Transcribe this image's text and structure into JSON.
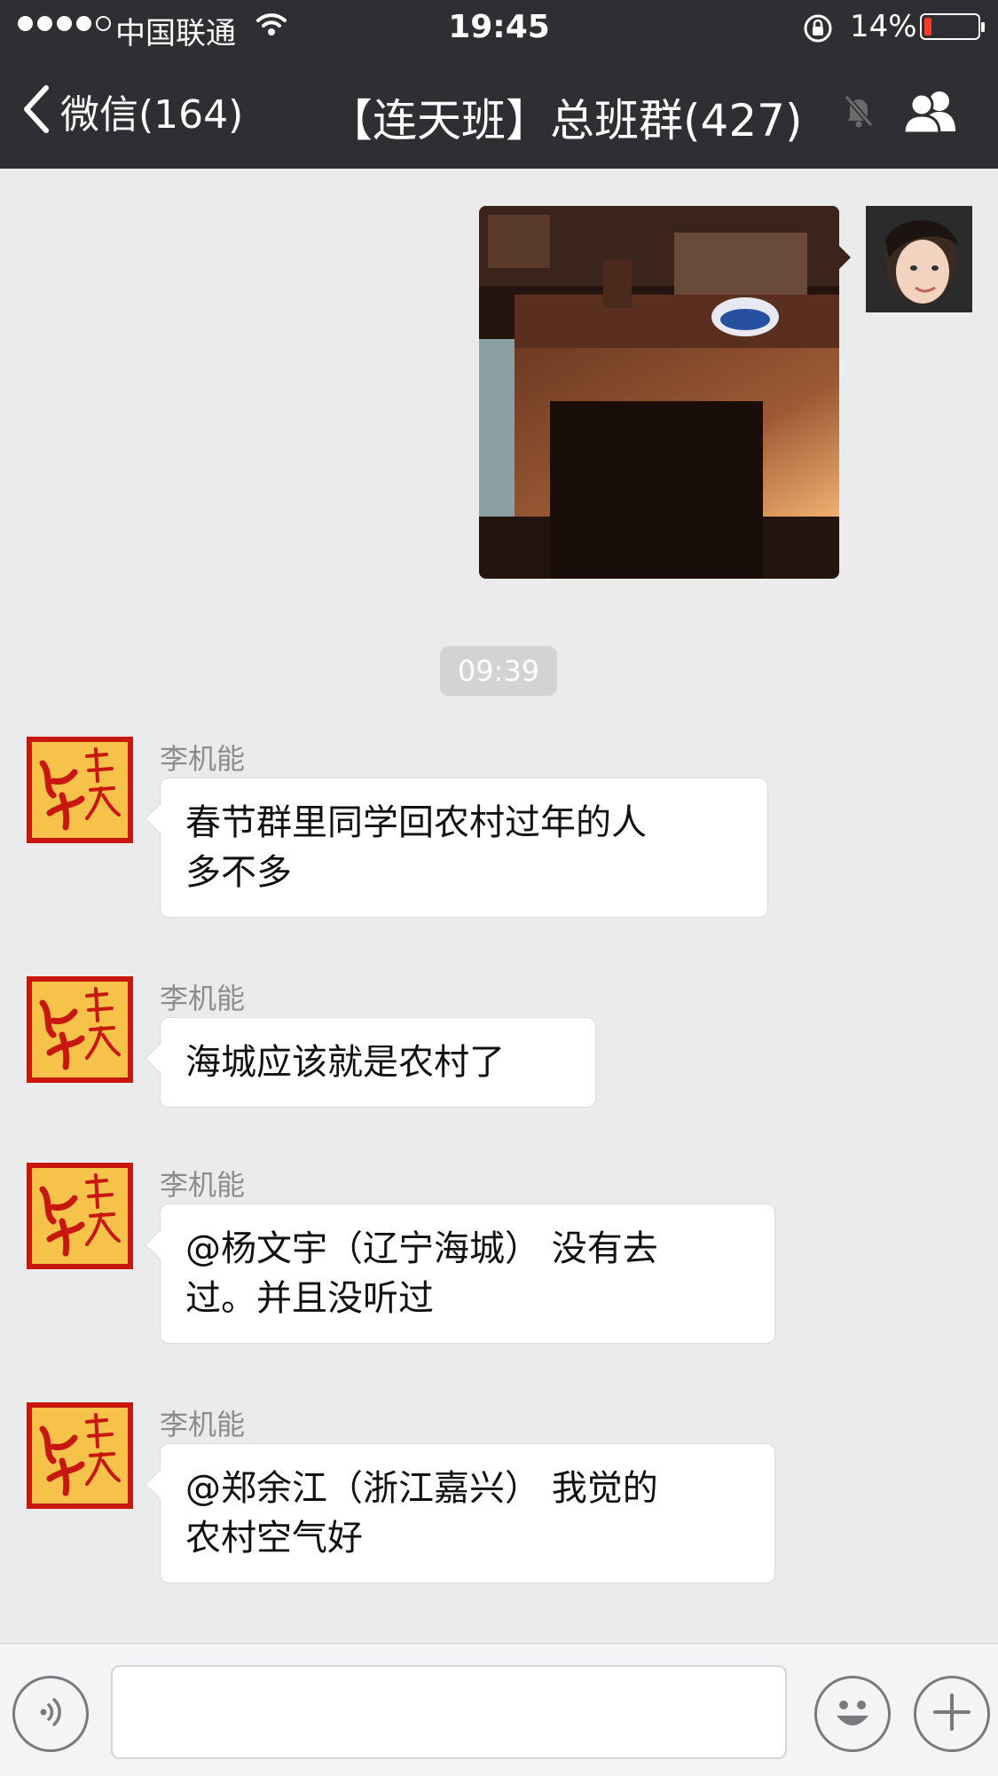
{
  "status": {
    "carrier": "中国联通",
    "time": "19:45",
    "battery": "14%",
    "battery_level": 0.14
  },
  "nav": {
    "back_label": "微信(164)",
    "title": "【连天班】总班群(427)"
  },
  "chat": {
    "timestamp": "09:39",
    "messages": [
      {
        "sender": "李机能",
        "lines": [
          "春节群里同学回农村过年的人",
          "多不多"
        ]
      },
      {
        "sender": "李机能",
        "lines": [
          "海城应该就是农村了"
        ]
      },
      {
        "sender": "李机能",
        "lines": [
          "@杨文宇（辽宁海城） 没有去",
          "过。并且没听过"
        ]
      },
      {
        "sender": "李机能",
        "lines": [
          "@郑余江（浙江嘉兴） 我觉的",
          "农村空气好"
        ]
      }
    ]
  },
  "icons": {
    "back": "chevron-left-icon",
    "mute": "mute-bell-icon",
    "group": "group-members-icon",
    "voice": "voice-input-icon",
    "emoji": "emoji-icon",
    "more": "plus-icon"
  },
  "colors": {
    "nav_bg": "#2f2f33",
    "chat_bg": "#ebebeb",
    "battery_low": "#ff3b30",
    "avatar_red": "#d11f16"
  }
}
